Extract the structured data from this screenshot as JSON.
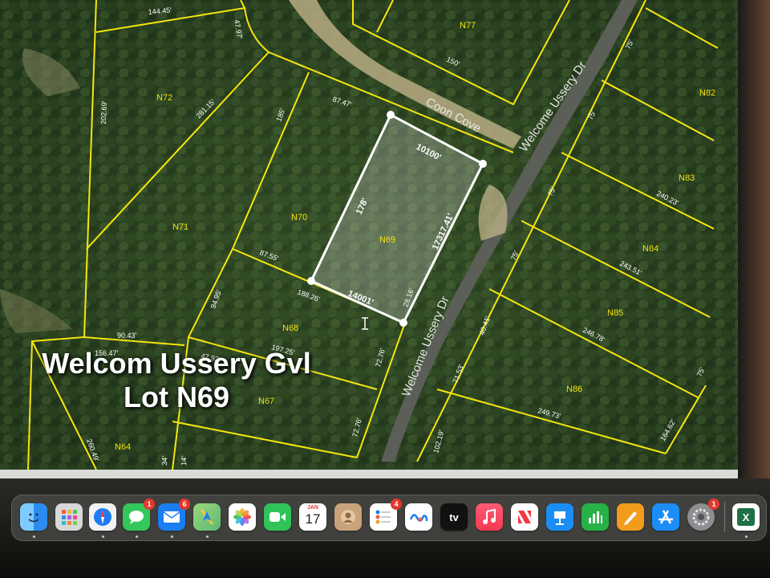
{
  "overlay": {
    "line1": "Welcom Ussery Gvl",
    "line2": "Lot N69"
  },
  "map": {
    "roads": {
      "coon_cove": "Coon Cove",
      "welcome_ussery_upper": "Welcome Ussery Dr",
      "welcome_ussery_lower": "Welcome Ussery Dr"
    },
    "lots": {
      "n77": "N77",
      "n72": "N72",
      "n71": "N71",
      "n70": "N70",
      "n69": "N69",
      "n68": "N68",
      "n67": "N67",
      "n64": "N64",
      "n82": "N82",
      "n83": "N83",
      "n84": "N84",
      "n85": "N85",
      "n86": "N86"
    },
    "dims": {
      "d144": "144.45'",
      "d47_97": "47.97'",
      "d202": "202.69'",
      "d281": "281.15'",
      "d185": "185'",
      "d87_47": "87.47'",
      "d150": "150'",
      "d75a": "75'",
      "d75b": "75'",
      "d75c": "75'",
      "d75d": "75'",
      "d240": "240.23'",
      "d243": "243.51'",
      "d246": "246.78'",
      "d249": "249.73'",
      "d164": "164.62'",
      "d40": "40.41'",
      "d71": "71.53'",
      "d102": "102.19'",
      "d87_55": "87.55'",
      "d188": "188.26'",
      "d94": "94.95'",
      "d90": "90.43'",
      "d156": "156.47'",
      "d47_92": "47.92'",
      "d197": "197.25'",
      "d72a": "72.76'",
      "d72b": "72.76'",
      "d28": "28.16'",
      "d260": "260.49'",
      "d34": "34'",
      "d14": "14'",
      "d75e": "75'"
    },
    "selection": {
      "top": "10100'",
      "left": "178'",
      "right": "17317.41'",
      "bottom": "14001'"
    }
  },
  "dock": {
    "calendar_month": "JAN",
    "calendar_day": "17",
    "messages_badge": "1",
    "mail_badge": "6",
    "reminders_badge": "4",
    "settings_badge": "1",
    "tv_label": "tv",
    "excel_label": "X",
    "colors": {
      "finder": "#2a8cf0",
      "safari": "#1e7cf2",
      "messages": "#34c759",
      "mail": "#1a7df2",
      "maps": "#5bb974",
      "facetime": "#30c35a",
      "music": "#f53a50",
      "news": "#f2373f",
      "keynote": "#1b8ef5",
      "numbers": "#27b146",
      "pages": "#f29b1d",
      "appstore": "#1c8cf6",
      "excel": "#1e7145"
    }
  }
}
